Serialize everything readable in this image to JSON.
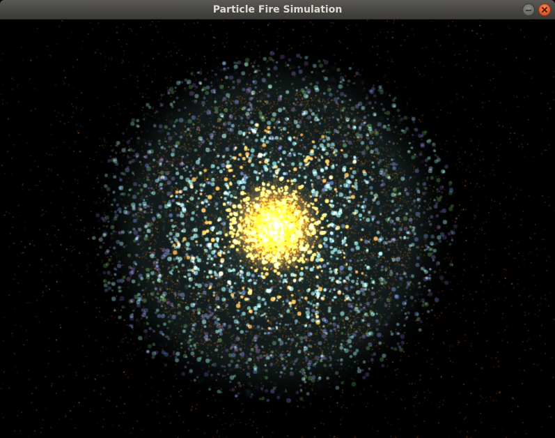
{
  "window": {
    "title": "Particle Fire Simulation",
    "controls": {
      "minimize_icon": "minimize-icon",
      "close_icon": "close-icon"
    }
  },
  "simulation": {
    "background_color": "#000000",
    "colors": {
      "core": "#ff7a00",
      "inner_glow": "#ffb347",
      "mid_cyan": "#6fa8a8",
      "mid_blue": "#4a5a8a",
      "outer_green": "#3d6a3a",
      "outer_purple": "#4a3a6a",
      "spark": "#c8641e"
    }
  }
}
